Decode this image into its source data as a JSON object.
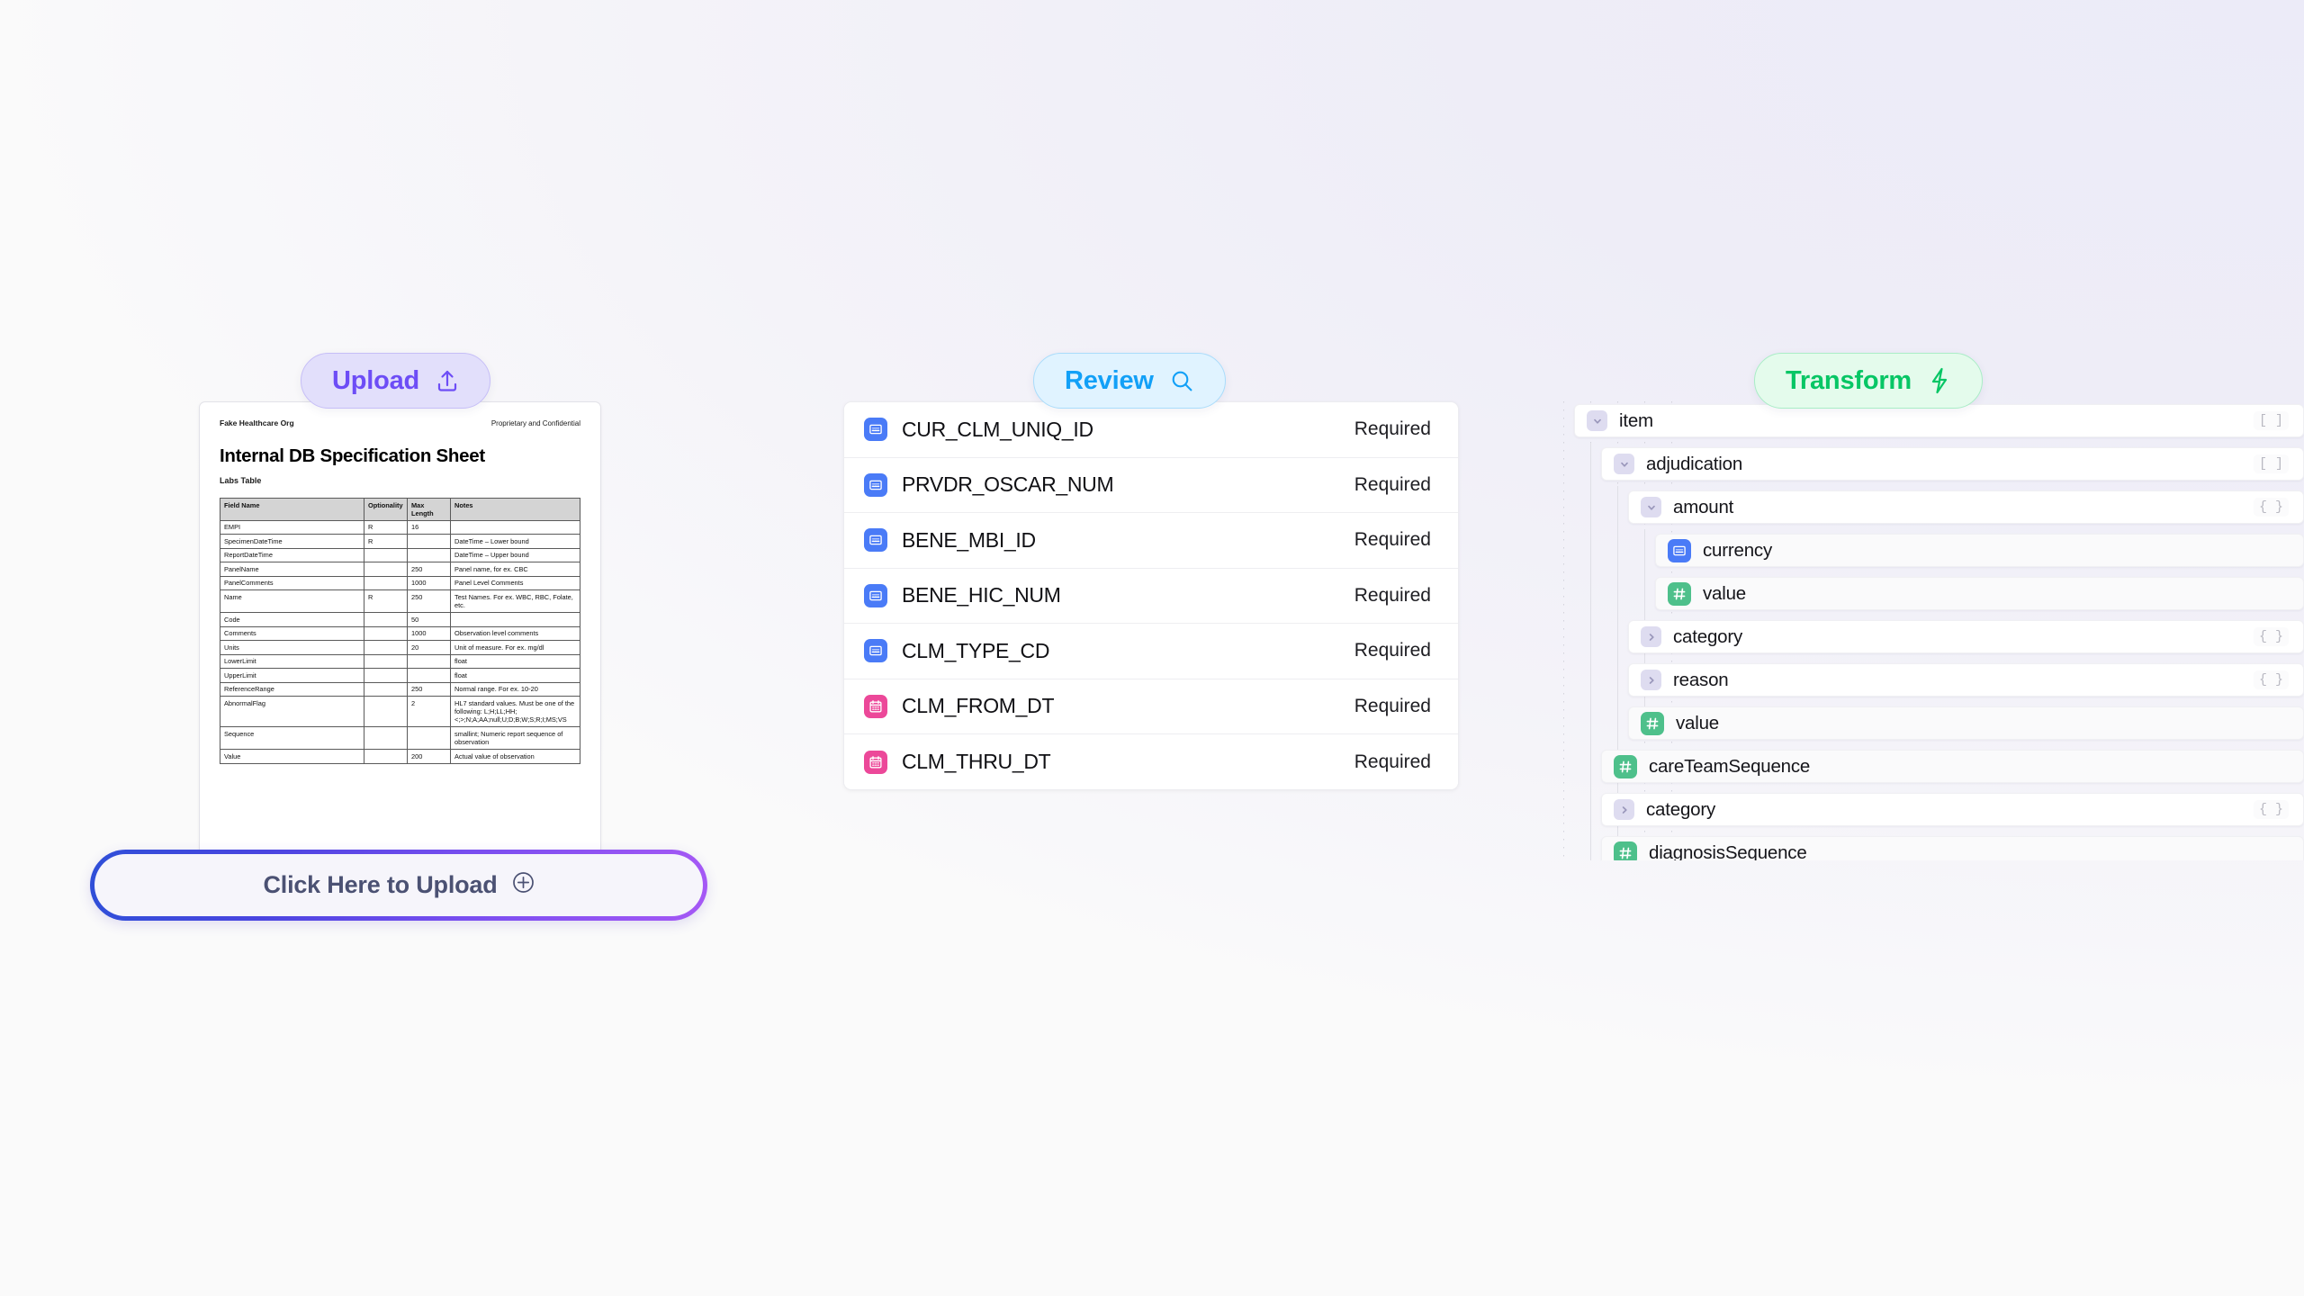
{
  "stages": {
    "upload": {
      "label": "Upload",
      "icon": "upload-arrow-icon"
    },
    "review": {
      "label": "Review",
      "icon": "magnifier-icon"
    },
    "transform": {
      "label": "Transform",
      "icon": "lightning-bolt-icon"
    }
  },
  "colors": {
    "upload_accent": "#6d4df6",
    "upload_bg": "#e2dffb",
    "review_accent": "#12a0f7",
    "review_bg": "#e0f3ff",
    "transform_accent": "#07c665",
    "transform_bg": "#e4fbec",
    "string_type": "#4a7bf7",
    "date_type": "#ec4899",
    "number_type": "#4ec08b",
    "upload_border_start": "#2f4fd8",
    "upload_border_end": "#a558f5"
  },
  "document": {
    "org": "Fake Healthcare Org",
    "confidentiality": "Proprietary and Confidential",
    "title": "Internal DB Specification Sheet",
    "section": "Labs Table",
    "table": {
      "columns": [
        "Field Name",
        "Optionality",
        "Max Length",
        "Notes"
      ],
      "rows": [
        [
          "EMPI",
          "R",
          "16",
          ""
        ],
        [
          "SpecimenDateTime",
          "R",
          "",
          "DateTime – Lower bound"
        ],
        [
          "ReportDateTime",
          "",
          "",
          "DateTime – Upper bound"
        ],
        [
          "PanelName",
          "",
          "250",
          "Panel name, for ex. CBC"
        ],
        [
          "PanelComments",
          "",
          "1000",
          "Panel Level Comments"
        ],
        [
          "Name",
          "R",
          "250",
          "Test Names. For ex. WBC, RBC, Folate, etc."
        ],
        [
          "Code",
          "",
          "50",
          ""
        ],
        [
          "Comments",
          "",
          "1000",
          "Observation level comments"
        ],
        [
          "Units",
          "",
          "20",
          "Unit of measure. For ex. mg/dl"
        ],
        [
          "LowerLimit",
          "",
          "",
          "float"
        ],
        [
          "UpperLimit",
          "",
          "",
          "float"
        ],
        [
          "ReferenceRange",
          "",
          "250",
          "Normal range. For ex. 10-20"
        ],
        [
          "AbnormalFlag",
          "",
          "2",
          "HL7 standard values. Must be one of the following: L;H;LL;HH;<;>;N;A;AA;null;U;D;B;W;S;R;I;MS;VS"
        ],
        [
          "Sequence",
          "",
          "",
          "smallint; Numeric report sequence of observation"
        ],
        [
          "Value",
          "",
          "200",
          "Actual value of observation"
        ]
      ]
    }
  },
  "upload_button": {
    "label": "Click Here to Upload",
    "icon": "plus-circle-icon"
  },
  "review": {
    "fields": [
      {
        "name": "CUR_CLM_UNIQ_ID",
        "type": "string",
        "status": "Required"
      },
      {
        "name": "PRVDR_OSCAR_NUM",
        "type": "string",
        "status": "Required"
      },
      {
        "name": "BENE_MBI_ID",
        "type": "string",
        "status": "Required"
      },
      {
        "name": "BENE_HIC_NUM",
        "type": "string",
        "status": "Required"
      },
      {
        "name": "CLM_TYPE_CD",
        "type": "string",
        "status": "Required"
      },
      {
        "name": "CLM_FROM_DT",
        "type": "date",
        "status": "Required"
      },
      {
        "name": "CLM_THRU_DT",
        "type": "date",
        "status": "Required"
      }
    ]
  },
  "transform": {
    "nodes": [
      {
        "label": "item",
        "depth": 0,
        "kind": "branch",
        "expanded": true,
        "marker": "[ ]"
      },
      {
        "label": "adjudication",
        "depth": 1,
        "kind": "branch",
        "expanded": true,
        "marker": "[ ]"
      },
      {
        "label": "amount",
        "depth": 2,
        "kind": "branch",
        "expanded": true,
        "marker": "{ }"
      },
      {
        "label": "currency",
        "depth": 3,
        "kind": "string",
        "expanded": null,
        "marker": ""
      },
      {
        "label": "value",
        "depth": 3,
        "kind": "number",
        "expanded": null,
        "marker": ""
      },
      {
        "label": "category",
        "depth": 2,
        "kind": "branch",
        "expanded": false,
        "marker": "{ }"
      },
      {
        "label": "reason",
        "depth": 2,
        "kind": "branch",
        "expanded": false,
        "marker": "{ }"
      },
      {
        "label": "value",
        "depth": 2,
        "kind": "number",
        "expanded": null,
        "marker": ""
      },
      {
        "label": "careTeamSequence",
        "depth": 1,
        "kind": "number",
        "expanded": null,
        "marker": ""
      },
      {
        "label": "category",
        "depth": 1,
        "kind": "branch",
        "expanded": false,
        "marker": "{ }"
      },
      {
        "label": "diagnosisSequence",
        "depth": 1,
        "kind": "number",
        "expanded": null,
        "marker": ""
      }
    ]
  }
}
